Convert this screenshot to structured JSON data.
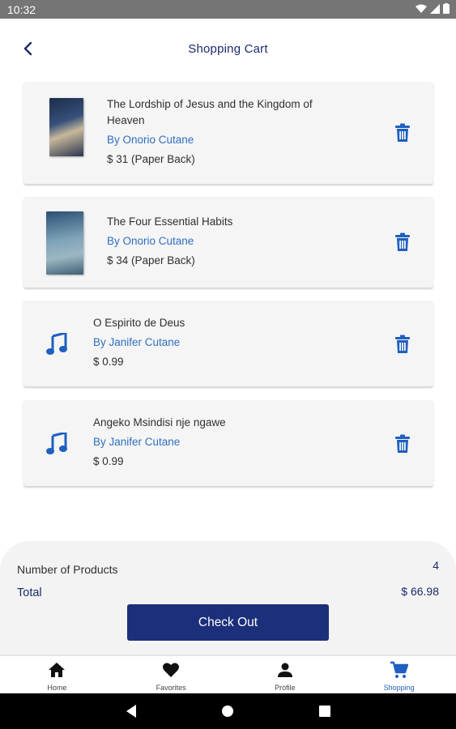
{
  "status_bar": {
    "time": "10:32"
  },
  "header": {
    "title": "Shopping Cart"
  },
  "cart": {
    "items": [
      {
        "title": "The Lordship of Jesus and the Kingdom of Heaven",
        "author": "By Onorio Cutane",
        "price": "$ 31 (Paper Back)",
        "type": "book-cover"
      },
      {
        "title": "The Four Essential Habits",
        "author": "By Onorio Cutane",
        "price": "$ 34 (Paper Back)",
        "type": "book-cover"
      },
      {
        "title": "O Espirito de Deus",
        "author": "By Janifer Cutane",
        "price": "$ 0.99",
        "type": "music-note-icon"
      },
      {
        "title": "Angeko Msindisi nje ngawe",
        "author": "By Janifer Cutane",
        "price": "$ 0.99",
        "type": "music-note-icon"
      }
    ]
  },
  "summary": {
    "products_label": "Number of Products",
    "products_value": "4",
    "total_label": "Total",
    "total_value": "$ 66.98",
    "checkout_label": "Check Out"
  },
  "bottom_nav": {
    "items": [
      {
        "label": "Home",
        "icon": "home-icon"
      },
      {
        "label": "Favorites",
        "icon": "heart-icon"
      },
      {
        "label": "Profile",
        "icon": "person-icon"
      },
      {
        "label": "Shopping",
        "icon": "cart-icon"
      }
    ],
    "active": "Shopping"
  },
  "colors": {
    "accent": "#1b2f7a",
    "link": "#2e6fc0",
    "active_nav": "#1f5fbf",
    "card_bg": "#f5f5f5"
  }
}
